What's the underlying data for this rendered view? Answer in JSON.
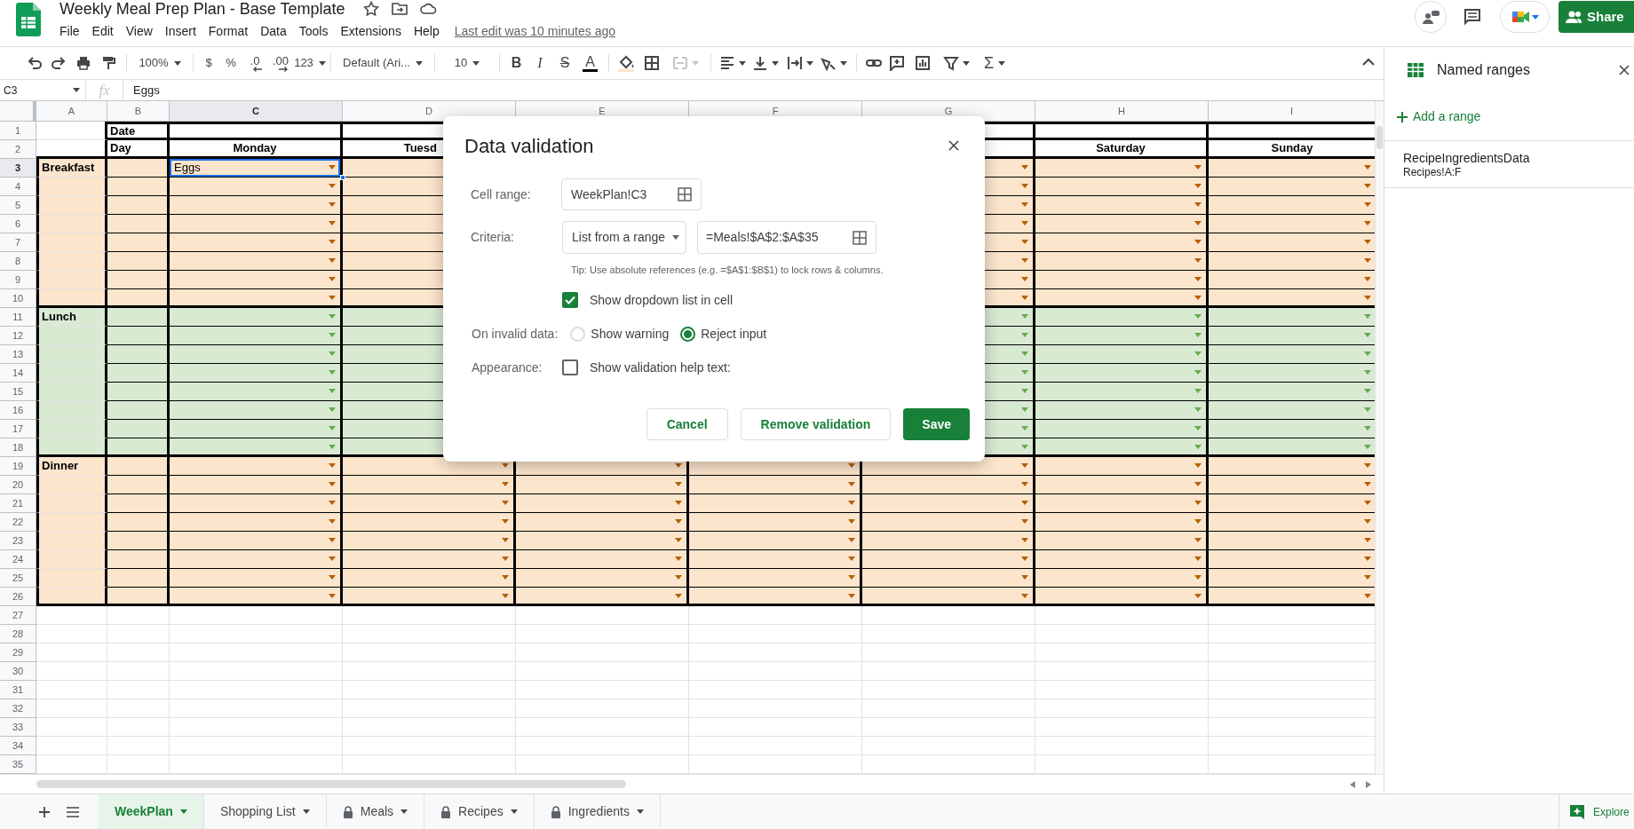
{
  "app": {
    "title": "Weekly Meal Prep Plan - Base Template",
    "menu": [
      "File",
      "Edit",
      "View",
      "Insert",
      "Format",
      "Data",
      "Tools",
      "Extensions",
      "Help"
    ],
    "last_edit": "Last edit was 10 minutes ago",
    "share": "Share"
  },
  "toolbar": {
    "zoom": "100%",
    "currency": "$",
    "percent": "%",
    "decimal_decrease": ".0",
    "decimal_increase": ".00",
    "number_format": "123",
    "font": "Default (Ari...",
    "font_size": "10",
    "bold": "B",
    "italic": "I",
    "strikethrough": "S",
    "text_color": "A",
    "functions": "Σ"
  },
  "formula_bar": {
    "cell": "C3",
    "fx": "fx",
    "value": "Eggs"
  },
  "grid": {
    "columns": [
      {
        "label": "A",
        "selected": false
      },
      {
        "label": "B",
        "selected": false
      },
      {
        "label": "C",
        "selected": true
      },
      {
        "label": "D",
        "selected": false
      },
      {
        "label": "E",
        "selected": false
      },
      {
        "label": "F",
        "selected": false
      },
      {
        "label": "G",
        "selected": false
      },
      {
        "label": "H",
        "selected": false
      },
      {
        "label": "I",
        "selected": false
      }
    ],
    "rows": [
      {
        "number": "1",
        "kind": "date",
        "selected": false,
        "label": "Date"
      },
      {
        "number": "2",
        "kind": "days",
        "selected": false,
        "label": "Day",
        "days": [
          "Monday",
          "Tuesd"
        ],
        "weekend_days": [
          "Saturday",
          "Sunday"
        ]
      },
      {
        "number": "3",
        "kind": "meal",
        "selected": true,
        "color": "#fce5cd",
        "label": "Breakfast",
        "entries": [
          {
            "text": "Eggs",
            "selected": true
          }
        ]
      },
      {
        "number": "4",
        "kind": "meal",
        "selected": false,
        "color": "#fce5cd"
      },
      {
        "number": "5",
        "kind": "meal",
        "selected": false,
        "color": "#fce5cd"
      },
      {
        "number": "6",
        "kind": "meal",
        "selected": false,
        "color": "#fce5cd"
      },
      {
        "number": "7",
        "kind": "meal",
        "selected": false,
        "color": "#fce5cd"
      },
      {
        "number": "8",
        "kind": "meal",
        "selected": false,
        "color": "#fce5cd"
      },
      {
        "number": "9",
        "kind": "meal",
        "selected": false,
        "color": "#fce5cd"
      },
      {
        "number": "10",
        "kind": "meal",
        "selected": false,
        "color": "#fce5cd"
      },
      {
        "number": "11",
        "kind": "meal",
        "selected": false,
        "color": "#d9ead3",
        "label": "Lunch"
      },
      {
        "number": "12",
        "kind": "meal",
        "selected": false,
        "color": "#d9ead3"
      },
      {
        "number": "13",
        "kind": "meal",
        "selected": false,
        "color": "#d9ead3"
      },
      {
        "number": "14",
        "kind": "meal",
        "selected": false,
        "color": "#d9ead3"
      },
      {
        "number": "15",
        "kind": "meal",
        "selected": false,
        "color": "#d9ead3"
      },
      {
        "number": "16",
        "kind": "meal",
        "selected": false,
        "color": "#d9ead3"
      },
      {
        "number": "17",
        "kind": "meal",
        "selected": false,
        "color": "#d9ead3"
      },
      {
        "number": "18",
        "kind": "meal",
        "selected": false,
        "color": "#d9ead3"
      },
      {
        "number": "19",
        "kind": "meal",
        "selected": false,
        "color": "#fce5cd",
        "label": "Dinner"
      },
      {
        "number": "20",
        "kind": "meal",
        "selected": false,
        "color": "#fce5cd"
      },
      {
        "number": "21",
        "kind": "meal",
        "selected": false,
        "color": "#fce5cd"
      },
      {
        "number": "22",
        "kind": "meal",
        "selected": false,
        "color": "#fce5cd"
      },
      {
        "number": "23",
        "kind": "meal",
        "selected": false,
        "color": "#fce5cd"
      },
      {
        "number": "24",
        "kind": "meal",
        "selected": false,
        "color": "#fce5cd"
      },
      {
        "number": "25",
        "kind": "meal",
        "selected": false,
        "color": "#fce5cd"
      },
      {
        "number": "26",
        "kind": "meal",
        "selected": false,
        "color": "#fce5cd"
      },
      {
        "number": "27",
        "kind": "empty",
        "selected": false
      },
      {
        "number": "28",
        "kind": "empty",
        "selected": false
      },
      {
        "number": "29",
        "kind": "empty",
        "selected": false
      },
      {
        "number": "30",
        "kind": "empty",
        "selected": false
      },
      {
        "number": "31",
        "kind": "empty",
        "selected": false
      },
      {
        "number": "32",
        "kind": "empty",
        "selected": false
      },
      {
        "number": "33",
        "kind": "empty",
        "selected": false
      },
      {
        "number": "34",
        "kind": "empty",
        "selected": false
      },
      {
        "number": "35",
        "kind": "empty",
        "selected": false
      }
    ]
  },
  "dialog": {
    "title": "Data validation",
    "cell_range": {
      "label": "Cell range:",
      "value": "WeekPlan!C3"
    },
    "criteria": {
      "label": "Criteria:",
      "type": "List from a range",
      "value": "=Meals!$A$2:$A$35",
      "tip": "Tip: Use absolute references (e.g. =$A$1:$B$1) to lock rows & columns."
    },
    "show_dropdown": {
      "label": "Show dropdown list in cell",
      "checked": true
    },
    "on_invalid": {
      "label": "On invalid data:",
      "options": [
        {
          "label": "Show warning",
          "selected": false
        },
        {
          "label": "Reject input",
          "selected": true
        }
      ]
    },
    "appearance": {
      "label": "Appearance:",
      "option": {
        "label": "Show validation help text:",
        "checked": false
      }
    },
    "buttons": [
      {
        "label": "Cancel",
        "kind": "secondary"
      },
      {
        "label": "Remove validation",
        "kind": "secondary"
      },
      {
        "label": "Save",
        "kind": "primary"
      }
    ]
  },
  "side_panel": {
    "title": "Named ranges",
    "add": "Add a range",
    "ranges": [
      {
        "name": "RecipeIngredientsData",
        "range": "Recipes!A:F"
      }
    ]
  },
  "sheet_tabs": [
    {
      "label": "WeekPlan",
      "selected": true,
      "locked": false
    },
    {
      "label": "Shopping List",
      "selected": false,
      "locked": false
    },
    {
      "label": "Meals",
      "selected": false,
      "locked": true
    },
    {
      "label": "Recipes",
      "selected": false,
      "locked": true
    },
    {
      "label": "Ingredients",
      "selected": false,
      "locked": true
    }
  ],
  "explore": "Explore"
}
